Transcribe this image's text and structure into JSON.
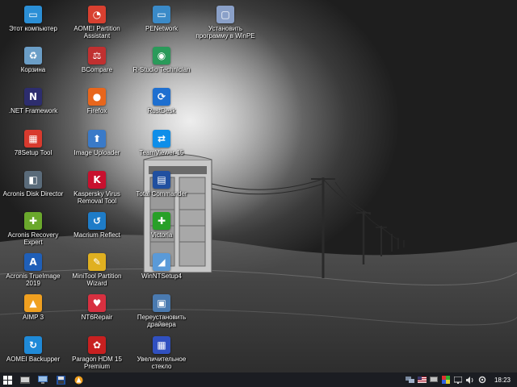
{
  "desktop_icons": [
    {
      "label": "Этот компьютер",
      "icon": "computer-icon",
      "color": "#2b8fd6"
    },
    {
      "label": "Корзина",
      "icon": "recycle-bin-icon",
      "color": "#6b9ec7"
    },
    {
      "label": ".NET Framework",
      "icon": "dotnet-icon",
      "color": "#2d2d6e"
    },
    {
      "label": "78Setup Tool",
      "icon": "setup-tool-icon",
      "color": "#d83a2e"
    },
    {
      "label": "Acronis Disk Director",
      "icon": "disk-director-icon",
      "color": "#5a6b7a"
    },
    {
      "label": "Acronis Recovery Expert",
      "icon": "recovery-expert-icon",
      "color": "#6aa82c"
    },
    {
      "label": "Acronis TrueImage 2019",
      "icon": "trueimage-icon",
      "color": "#1f5fb8"
    },
    {
      "label": "AIMP 3",
      "icon": "aimp-icon",
      "color": "#f0a020"
    },
    {
      "label": "AOMEI Backupper",
      "icon": "aomei-backupper-icon",
      "color": "#1f8ad8"
    },
    {
      "label": "AOMEI Partition Assistant",
      "icon": "partition-assistant-icon",
      "color": "#d84030"
    },
    {
      "label": "BCompare",
      "icon": "bcompare-icon",
      "color": "#c03030"
    },
    {
      "label": "Firefox",
      "icon": "firefox-icon",
      "color": "#e8661c"
    },
    {
      "label": "Image Uploader",
      "icon": "image-uploader-icon",
      "color": "#3a7ac8"
    },
    {
      "label": "Kaspersky Virus Removal Tool",
      "icon": "kaspersky-icon",
      "color": "#c8102e"
    },
    {
      "label": "Macrium Reflect",
      "icon": "macrium-icon",
      "color": "#1e7cc8"
    },
    {
      "label": "MiniTool Partition Wizard",
      "icon": "minitool-icon",
      "color": "#e0b020"
    },
    {
      "label": "NT6Repair",
      "icon": "nt6repair-icon",
      "color": "#d83040"
    },
    {
      "label": "Paragon HDM 15 Premium",
      "icon": "paragon-icon",
      "color": "#c82020"
    },
    {
      "label": "PENetwork",
      "icon": "penetwork-icon",
      "color": "#3a8ac8"
    },
    {
      "label": "R-Studio Technician",
      "icon": "rstudio-icon",
      "color": "#2a9a5a"
    },
    {
      "label": "RustDesk",
      "icon": "rustdesk-icon",
      "color": "#1e6fd0"
    },
    {
      "label": "TeamViewer 15",
      "icon": "teamviewer-icon",
      "color": "#0e8ee9"
    },
    {
      "label": "Total Commander",
      "icon": "total-commander-icon",
      "color": "#2050a0"
    },
    {
      "label": "Victoria",
      "icon": "victoria-icon",
      "color": "#28a028"
    },
    {
      "label": "WinNTSetup4",
      "icon": "winntsetup-icon",
      "color": "#5a9ad8"
    },
    {
      "label": "Переустановить драйвера",
      "icon": "reinstall-drivers-icon",
      "color": "#4a7ab0"
    },
    {
      "label": "Увеличительное стекло",
      "icon": "magnifier-icon",
      "color": "#3050c0"
    },
    {
      "label": "Установить программу в WinPE",
      "icon": "install-program-icon",
      "color": "#8aa0c8"
    }
  ],
  "taskbar": {
    "buttons": [
      {
        "icon": "start-icon"
      },
      {
        "icon": "explorer-icon"
      },
      {
        "icon": "network-monitor-icon"
      },
      {
        "icon": "total-commander-icon"
      },
      {
        "icon": "aimp-icon"
      }
    ],
    "tray": [
      {
        "icon": "network-tray-icon"
      },
      {
        "icon": "language-flag-icon"
      },
      {
        "icon": "display-tray-icon"
      },
      {
        "icon": "color-palette-tray-icon"
      },
      {
        "icon": "screen-tray-icon"
      },
      {
        "icon": "volume-icon"
      },
      {
        "icon": "settings-gear-icon"
      }
    ],
    "clock": "18:23",
    "background": "#1b1d22"
  }
}
